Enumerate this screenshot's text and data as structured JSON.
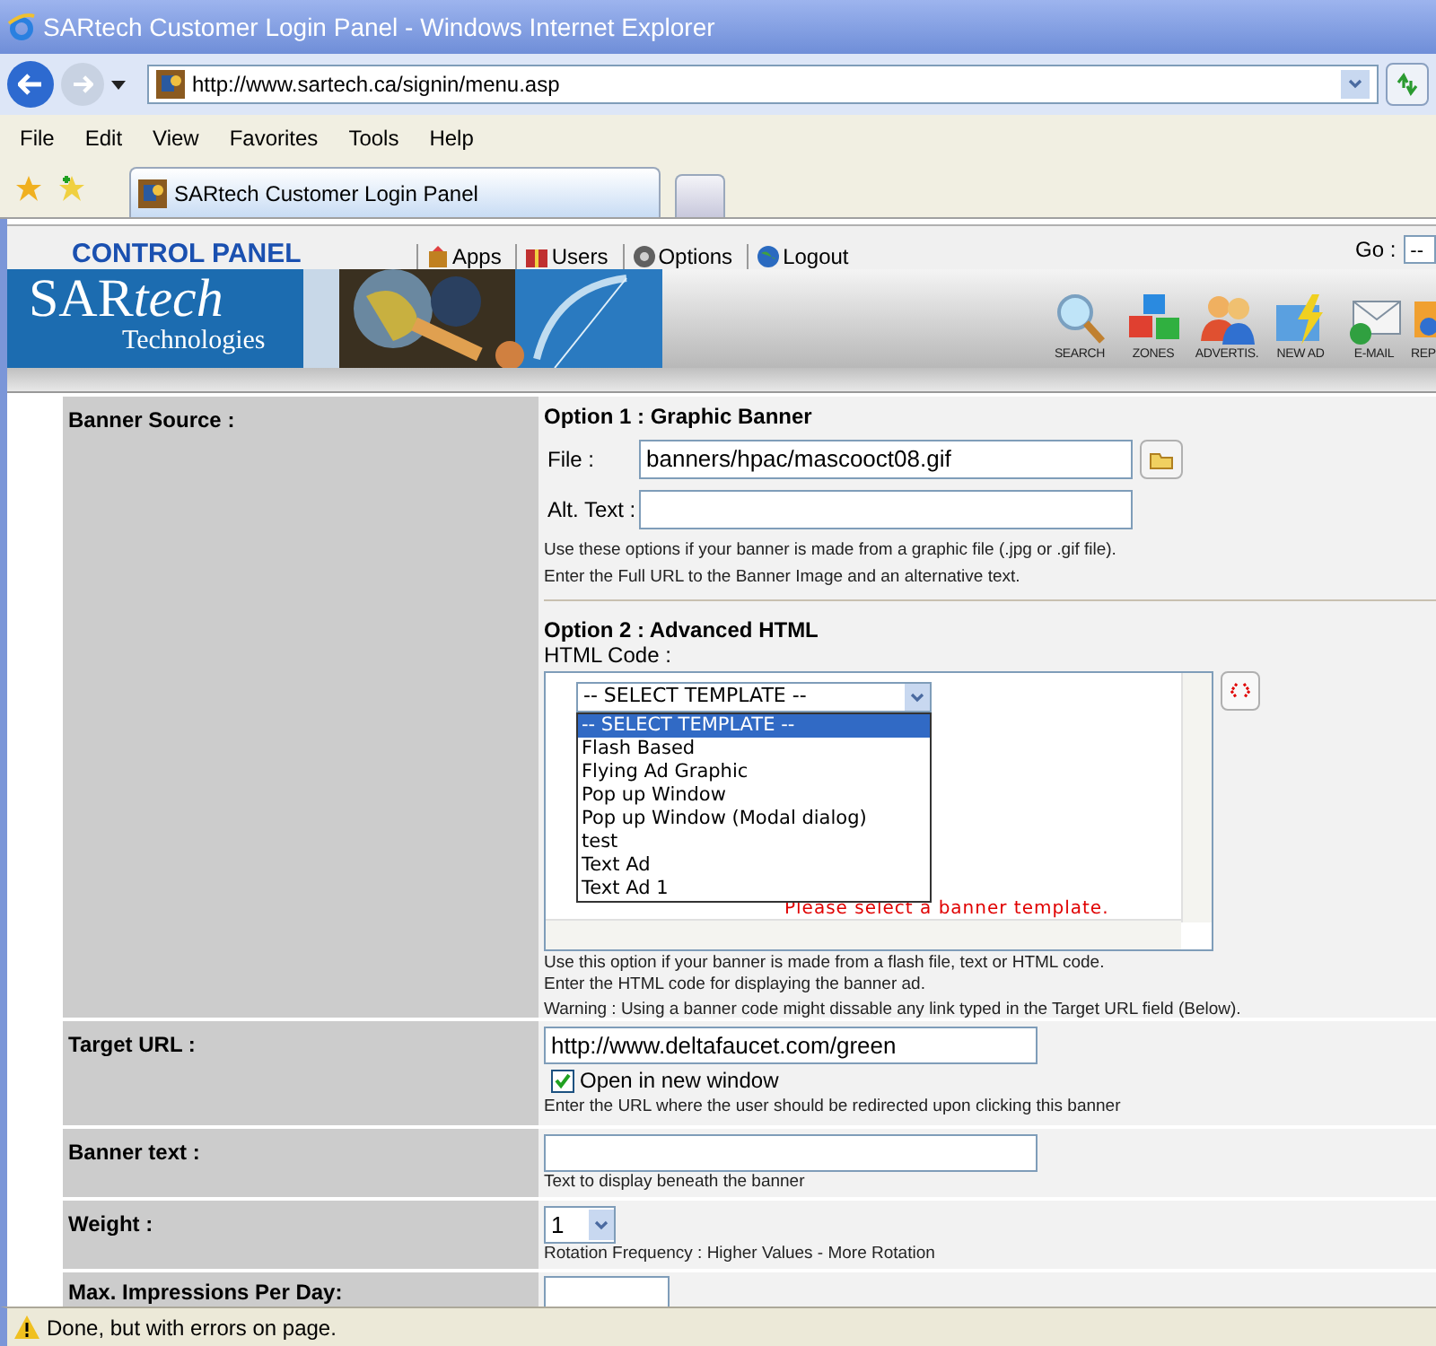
{
  "window": {
    "title": "SARtech Customer Login Panel - Windows Internet Explorer"
  },
  "address_bar": {
    "url": "http://www.sartech.ca/signin/menu.asp"
  },
  "menu": [
    "File",
    "Edit",
    "View",
    "Favorites",
    "Tools",
    "Help"
  ],
  "tabs": [
    {
      "label": "SARtech Customer Login Panel",
      "selected": true
    }
  ],
  "header": {
    "brand": "CONTROL PANEL",
    "nav": [
      {
        "label": "Apps",
        "kind": "apps"
      },
      {
        "label": "Users",
        "kind": "users"
      },
      {
        "label": "Options",
        "kind": "options"
      },
      {
        "label": "Logout",
        "kind": "logout"
      }
    ],
    "go": {
      "label": "Go :",
      "value": "--"
    },
    "logo": "SAR",
    "logo_italic": "tech",
    "logo_subtitle": "Technologies",
    "toolbar": [
      {
        "label": "SEARCH",
        "kind": "search"
      },
      {
        "label": "ZONES",
        "kind": "zones"
      },
      {
        "label": "ADVERTIS.",
        "kind": "advertisers"
      },
      {
        "label": "NEW AD",
        "kind": "new_ad"
      },
      {
        "label": "E-MAIL",
        "kind": "email"
      },
      {
        "label": "REP",
        "kind": "report"
      }
    ]
  },
  "form": {
    "banner_source": {
      "label": "Banner Source :",
      "option1": {
        "title": "Option 1 : Graphic Banner",
        "file_label": "File :",
        "file_value": "banners/hpac/mascooct08.gif",
        "alt_label": "Alt. Text :",
        "help": [
          "Use these options if your banner is made from a graphic file (.jpg or .gif file).",
          "Enter the Full URL to the Banner Image and an alternative text."
        ]
      },
      "option2": {
        "title": "Option 2 : Advanced HTML",
        "code_label": "HTML Code :",
        "template_value": "-- SELECT TEMPLATE --",
        "template_options": [
          {
            "label": "-- SELECT TEMPLATE --",
            "selected": true
          },
          {
            "label": "Flash Based",
            "selected": false
          },
          {
            "label": "Flying Ad Graphic",
            "selected": false
          },
          {
            "label": "Pop up Window",
            "selected": false
          },
          {
            "label": "Pop up Window (Modal dialog)",
            "selected": false
          },
          {
            "label": "test",
            "selected": false
          },
          {
            "label": "Text Ad",
            "selected": false
          },
          {
            "label": "Text Ad 1",
            "selected": false
          }
        ],
        "message": "Please select a banner template.",
        "help": [
          "Use this option if your banner is made from a flash file, text or HTML code.",
          "Enter the HTML code for displaying the banner ad."
        ],
        "warning": "Warning : Using a banner code might dissable any link typed in the Target URL field (Below)."
      }
    },
    "target_url": {
      "label": "Target URL :",
      "value": "http://www.deltafaucet.com/green",
      "new_window": {
        "label": "Open in new window",
        "checked": true
      },
      "help": "Enter the URL where the user should be redirected upon clicking this banner"
    },
    "banner_text": {
      "label": "Banner text :",
      "help": "Text to display beneath the banner"
    },
    "weight": {
      "label": "Weight :",
      "value": "1",
      "help": "Rotation Frequency : Higher Values - More Rotation"
    },
    "max_impressions": {
      "label": "Max. Impressions Per Day:"
    }
  },
  "status_bar": {
    "text": "Done, but with errors on page."
  }
}
